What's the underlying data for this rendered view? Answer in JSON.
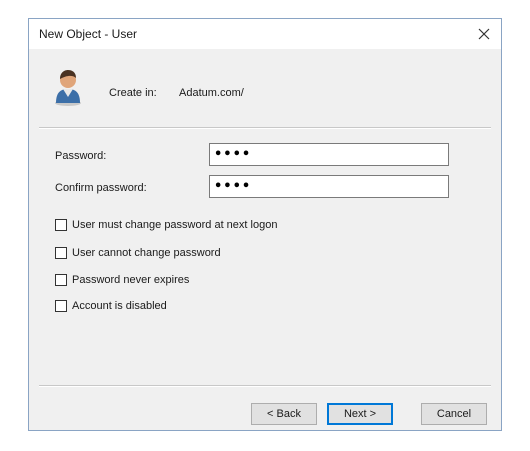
{
  "window": {
    "title": "New Object - User"
  },
  "header": {
    "create_in_label": "Create in:",
    "create_in_value": "Adatum.com/",
    "icon": "user-icon"
  },
  "form": {
    "password_label": "Password:",
    "password_value": "••••",
    "confirm_label": "Confirm password:",
    "confirm_value": "••••"
  },
  "options": [
    {
      "label": "User must change password at next logon",
      "checked": false
    },
    {
      "label": "User cannot change password",
      "checked": false
    },
    {
      "label": "Password never expires",
      "checked": false
    },
    {
      "label": "Account is disabled",
      "checked": false
    }
  ],
  "buttons": {
    "back": "< Back",
    "next": "Next >",
    "cancel": "Cancel"
  },
  "colors": {
    "accent": "#0078d7",
    "border": "#8aa4c4",
    "background": "#f0f0f0"
  }
}
